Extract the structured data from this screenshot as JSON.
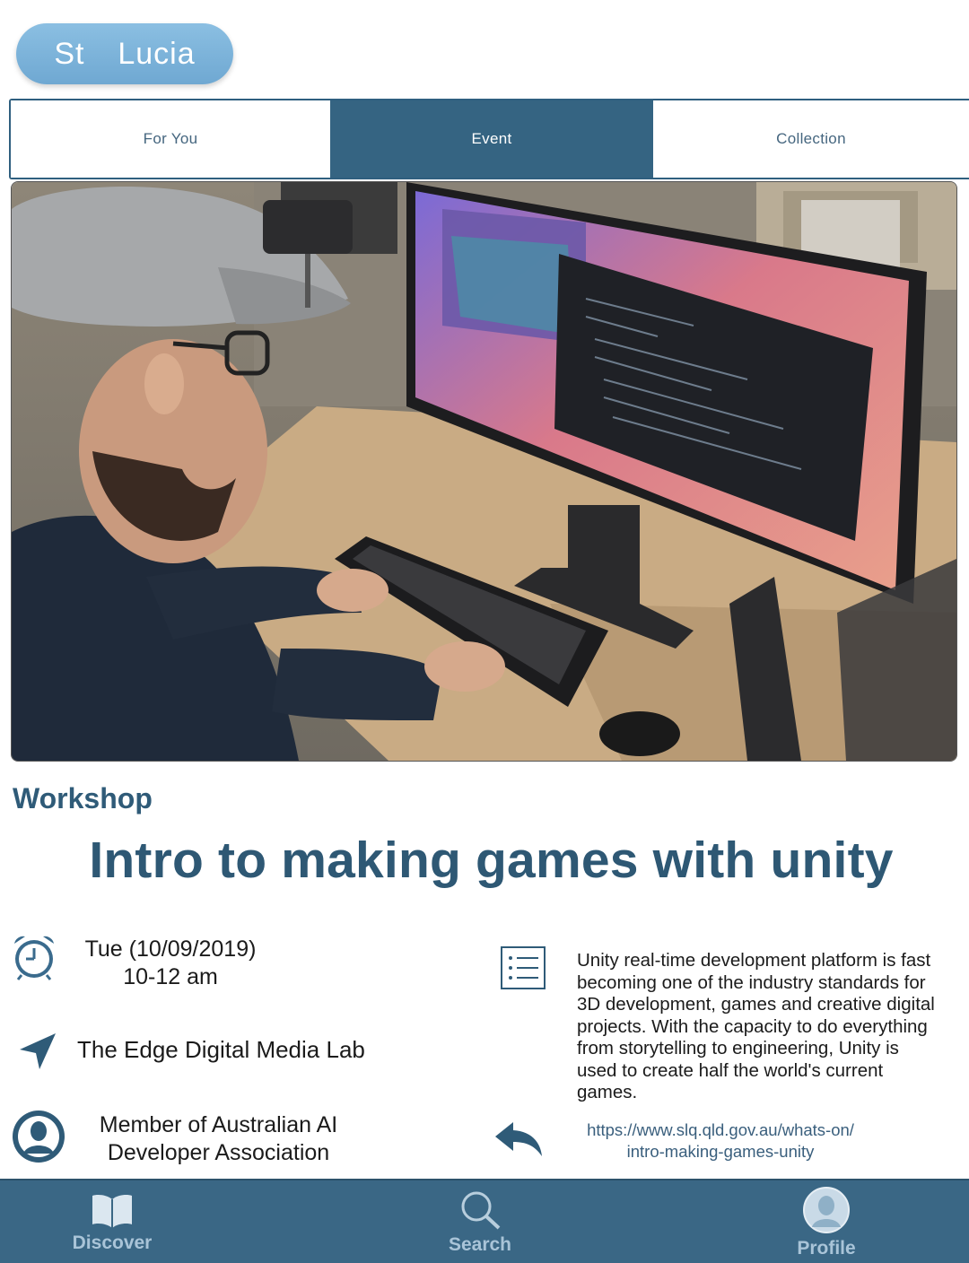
{
  "location": {
    "label": "St  Lucia"
  },
  "tabs": [
    {
      "label": "For You",
      "active": false
    },
    {
      "label": "Event",
      "active": true
    },
    {
      "label": "Collection",
      "active": false
    }
  ],
  "event": {
    "category": "Workshop",
    "title": "Intro to making games with unity",
    "date_line": "Tue (10/09/2019)",
    "time_line": "10-12 am",
    "venue": "The Edge Digital Media Lab",
    "host_line1": "Member of Australian AI",
    "host_line2": "Developer Association",
    "description": "Unity real-time development platform is fast becoming one of the industry standards for 3D development, games and creative digital projects. With the capacity to do everything from storytelling to engineering, Unity is used to create half the world's current games.",
    "link_line1": "https://www.slq.qld.gov.au/whats-on/",
    "link_line2": "intro-making-games-unity"
  },
  "icons": {
    "date": "alarm-clock-icon",
    "venue": "location-arrow-icon",
    "host": "user-avatar-icon",
    "description": "list-icon",
    "link": "share-back-arrow-icon"
  },
  "nav": [
    {
      "label": "Discover",
      "icon": "book-icon"
    },
    {
      "label": "Search",
      "icon": "search-icon"
    },
    {
      "label": "Profile",
      "icon": "profile-icon"
    }
  ],
  "colors": {
    "accent": "#356482",
    "pill": "#7ab3dc",
    "title": "#2e5874",
    "nav_bg": "#3a6785",
    "nav_label": "#a9c4d8"
  }
}
